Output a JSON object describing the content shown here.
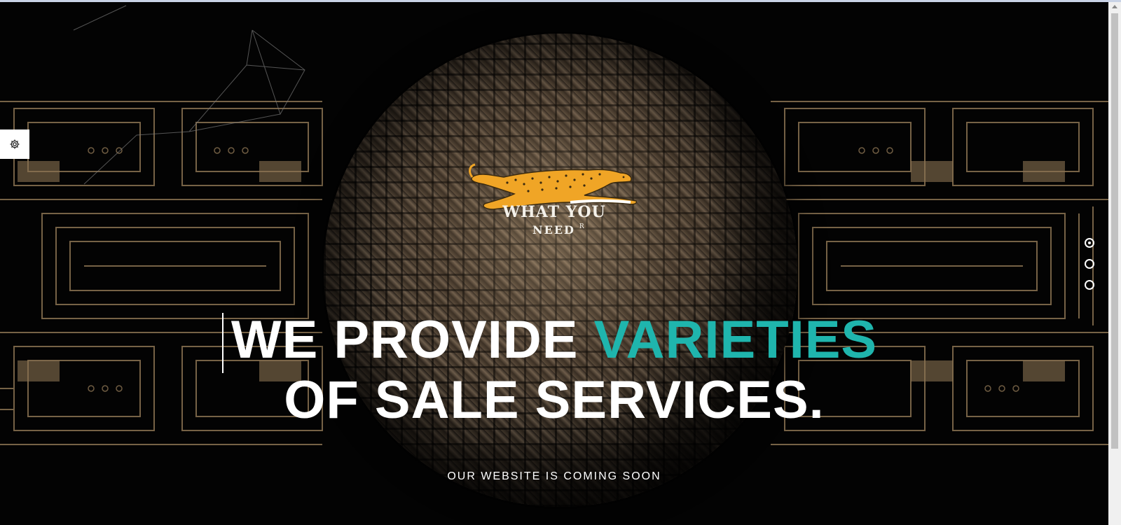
{
  "brand": {
    "line1": "WHAT YOU",
    "line2": "NEED",
    "reg": "R"
  },
  "hero": {
    "headline_white_1": "WE PROVIDE ",
    "headline_accent": "VARIETIES",
    "headline_white_2": "OF SALE SERVICES.",
    "subtitle": "OUR WEBSITE IS COMING SOON"
  },
  "colors": {
    "accent": "#1fb5ad",
    "background": "#030303",
    "circuit": "#8b7352",
    "cheetah": "#f0a526"
  },
  "icons": {
    "settings": "gear-icon",
    "logo": "cheetah-logo-icon"
  },
  "slider": {
    "dot_count": 3,
    "active_index": 0
  }
}
